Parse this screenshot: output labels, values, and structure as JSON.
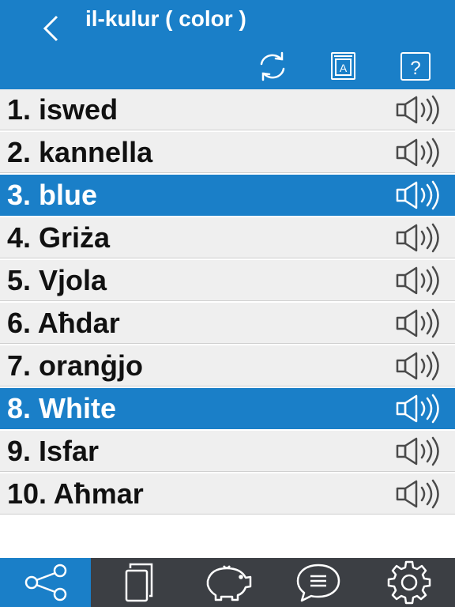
{
  "header": {
    "title": "il-kulur ( color )",
    "back_icon": "chevron-left-icon",
    "toolbar": [
      {
        "name": "refresh-icon"
      },
      {
        "name": "dictionary-book-icon"
      },
      {
        "name": "help-icon"
      }
    ]
  },
  "colors": {
    "accent": "#1a7fc8",
    "row_bg": "#efefef",
    "tabbar": "#3c3f44"
  },
  "items": [
    {
      "label": "1. iswed",
      "selected": false
    },
    {
      "label": "2. kannella",
      "selected": false
    },
    {
      "label": "3. blue",
      "selected": true
    },
    {
      "label": "4. Griża",
      "selected": false
    },
    {
      "label": "5. Vjola",
      "selected": false
    },
    {
      "label": "6. Aħdar",
      "selected": false
    },
    {
      "label": "7. oranġjo",
      "selected": false
    },
    {
      "label": "8. White",
      "selected": true
    },
    {
      "label": "9. Isfar",
      "selected": false
    },
    {
      "label": "10. Aħmar",
      "selected": false
    }
  ],
  "tabbar": [
    {
      "icon": "share-icon",
      "active": true
    },
    {
      "icon": "cards-icon",
      "active": false
    },
    {
      "icon": "piggy-bank-icon",
      "active": false
    },
    {
      "icon": "chat-icon",
      "active": false
    },
    {
      "icon": "settings-gear-icon",
      "active": false
    }
  ]
}
